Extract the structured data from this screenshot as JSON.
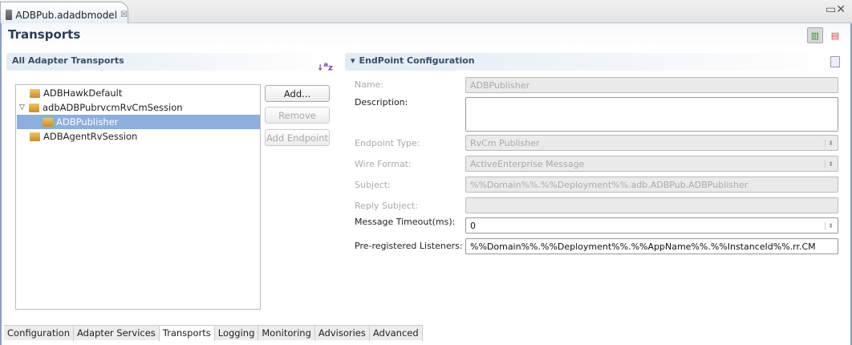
{
  "editor_tab": {
    "label": "ADBPub.adadbmodel",
    "close": "☒"
  },
  "window_controls": {
    "minmax": "▭✕"
  },
  "page": {
    "title": "Transports"
  },
  "toolbar": {
    "layout_icon": "columns-icon",
    "list_icon": "rows-icon"
  },
  "left": {
    "title": "All Adapter Transports",
    "sort_icon": "↓a z",
    "tree": [
      {
        "label": "ADBHawkDefault",
        "level": 0
      },
      {
        "label": "adbADBPubrvcmRvCmSession",
        "level": 0,
        "expanded": true
      },
      {
        "label": "ADBPublisher",
        "level": 1,
        "selected": true
      },
      {
        "label": "ADBAgentRvSession",
        "level": 0
      }
    ],
    "buttons": {
      "add": "Add...",
      "remove": "Remove",
      "add_endpoint": "Add Endpoint"
    }
  },
  "right": {
    "title": "EndPoint Configuration",
    "twisty": "▾",
    "fields": {
      "name": {
        "label": "Name:",
        "value": "ADBPublisher"
      },
      "description": {
        "label": "Description:",
        "value": ""
      },
      "endpoint_type": {
        "label": "Endpoint Type:",
        "value": "RvCm Publisher"
      },
      "wire_format": {
        "label": "Wire Format:",
        "value": "ActiveEnterprise Message"
      },
      "subject": {
        "label": "Subject:",
        "value": "%%Domain%%.%%Deployment%%.adb.ADBPub.ADBPublisher"
      },
      "reply_subject": {
        "label": "Reply Subject:",
        "value": ""
      },
      "timeout": {
        "label": "Message Timeout(ms):",
        "value": "0"
      },
      "listeners": {
        "label": "Pre-registered Listeners:",
        "value": "%%Domain%%.%%Deployment%%.%%AppName%%.%%InstanceId%%.rr.CM"
      }
    }
  },
  "bottom_tabs": [
    "Configuration",
    "Adapter Services",
    "Transports",
    "Logging",
    "Monitoring",
    "Advisories",
    "Advanced"
  ]
}
